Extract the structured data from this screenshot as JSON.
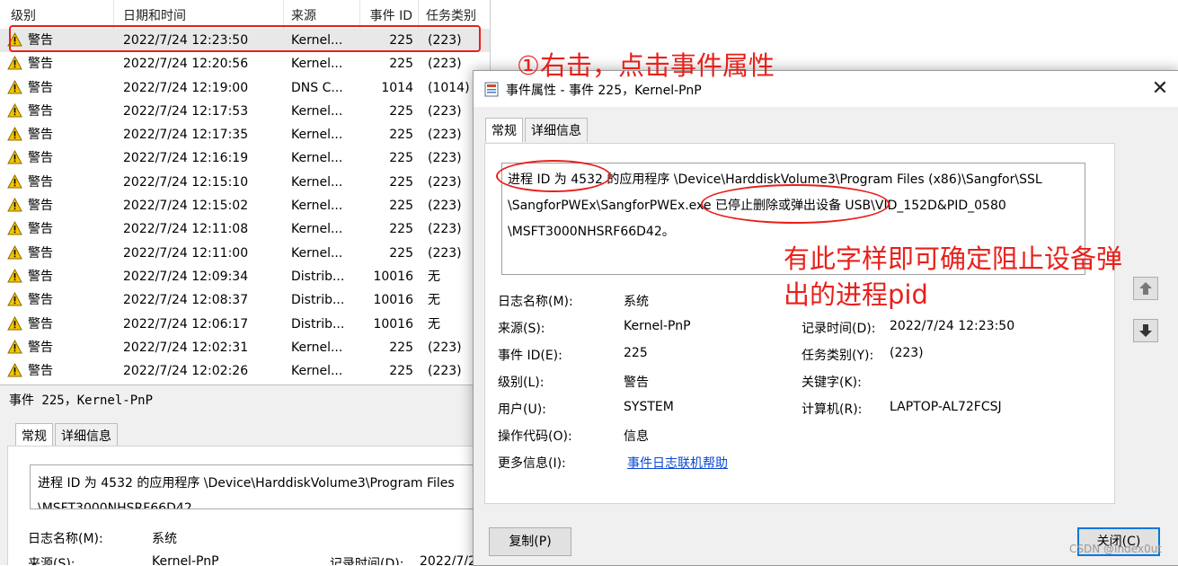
{
  "event_list": {
    "headers": [
      "级别",
      "日期和时间",
      "来源",
      "事件 ID",
      "任务类别"
    ],
    "rows": [
      {
        "level": "警告",
        "datetime": "2022/7/24 12:23:50",
        "source": "Kernel...",
        "event_id": "225",
        "task": "(223)"
      },
      {
        "level": "警告",
        "datetime": "2022/7/24 12:20:56",
        "source": "Kernel...",
        "event_id": "225",
        "task": "(223)"
      },
      {
        "level": "警告",
        "datetime": "2022/7/24 12:19:00",
        "source": "DNS C...",
        "event_id": "1014",
        "task": "(1014)"
      },
      {
        "level": "警告",
        "datetime": "2022/7/24 12:17:53",
        "source": "Kernel...",
        "event_id": "225",
        "task": "(223)"
      },
      {
        "level": "警告",
        "datetime": "2022/7/24 12:17:35",
        "source": "Kernel...",
        "event_id": "225",
        "task": "(223)"
      },
      {
        "level": "警告",
        "datetime": "2022/7/24 12:16:19",
        "source": "Kernel...",
        "event_id": "225",
        "task": "(223)"
      },
      {
        "level": "警告",
        "datetime": "2022/7/24 12:15:10",
        "source": "Kernel...",
        "event_id": "225",
        "task": "(223)"
      },
      {
        "level": "警告",
        "datetime": "2022/7/24 12:15:02",
        "source": "Kernel...",
        "event_id": "225",
        "task": "(223)"
      },
      {
        "level": "警告",
        "datetime": "2022/7/24 12:11:08",
        "source": "Kernel...",
        "event_id": "225",
        "task": "(223)"
      },
      {
        "level": "警告",
        "datetime": "2022/7/24 12:11:00",
        "source": "Kernel...",
        "event_id": "225",
        "task": "(223)"
      },
      {
        "level": "警告",
        "datetime": "2022/7/24 12:09:34",
        "source": "Distrib...",
        "event_id": "10016",
        "task": "无"
      },
      {
        "level": "警告",
        "datetime": "2022/7/24 12:08:37",
        "source": "Distrib...",
        "event_id": "10016",
        "task": "无"
      },
      {
        "level": "警告",
        "datetime": "2022/7/24 12:06:17",
        "source": "Distrib...",
        "event_id": "10016",
        "task": "无"
      },
      {
        "level": "警告",
        "datetime": "2022/7/24 12:02:31",
        "source": "Kernel...",
        "event_id": "225",
        "task": "(223)"
      },
      {
        "level": "警告",
        "datetime": "2022/7/24 12:02:26",
        "source": "Kernel...",
        "event_id": "225",
        "task": "(223)"
      }
    ]
  },
  "preview": {
    "title": "事件 225，Kernel-PnP",
    "tab_general": "常规",
    "tab_details": "详细信息",
    "message_line1": "进程 ID 为 4532 的应用程序 \\Device\\HarddiskVolume3\\Program Files",
    "message_line2": "\\MSFT3000NHSRF66D42",
    "log_name_label": "日志名称(M):",
    "log_name_value": "系统",
    "source_label": "来源(S):",
    "source_value": "Kernel-PnP",
    "logged_label": "记录时间(D):",
    "logged_value": "2022/7/2"
  },
  "dialog": {
    "title": "事件属性 - 事件 225，Kernel-PnP",
    "close_glyph": "✕",
    "tab_general": "常规",
    "tab_details": "详细信息",
    "message": {
      "line1_a": "进程 ID 为 4532",
      "line1_b": " 的应用程序 \\Device\\HarddiskVolume3\\Program Files (x86)\\Sangfor\\SSL",
      "line2_a": "\\SangforPWEx\\SangforPWEx.exe ",
      "line2_b": "已停止删除或弹出设备 USB",
      "line2_c": "\\VID_152D&PID_0580",
      "line3": "\\MSFT3000NHSRF66D42。"
    },
    "fields": {
      "log_name_label": "日志名称(M):",
      "log_name_value": "系统",
      "source_label": "来源(S):",
      "source_value": "Kernel-PnP",
      "event_id_label": "事件 ID(E):",
      "event_id_value": "225",
      "level_label": "级别(L):",
      "level_value": "警告",
      "user_label": "用户(U):",
      "user_value": "SYSTEM",
      "opcode_label": "操作代码(O):",
      "opcode_value": "信息",
      "more_info_label": "更多信息(I):",
      "more_info_link": "事件日志联机帮助",
      "logged_label": "记录时间(D):",
      "logged_value": "2022/7/24 12:23:50",
      "task_label": "任务类别(Y):",
      "task_value": "(223)",
      "keywords_label": "关键字(K):",
      "keywords_value": "",
      "computer_label": "计算机(R):",
      "computer_value": "LAPTOP-AL72FCSJ"
    },
    "copy_button": "复制(P)",
    "close_button": "关闭(C)"
  },
  "annotations": {
    "step1": "①右击，点击事件属性",
    "note_line1": "有此字样即可确定阻止设备弹",
    "note_line2": "出的进程pid",
    "color": "#e8201a"
  },
  "watermark": "CSDN @Index0ut"
}
